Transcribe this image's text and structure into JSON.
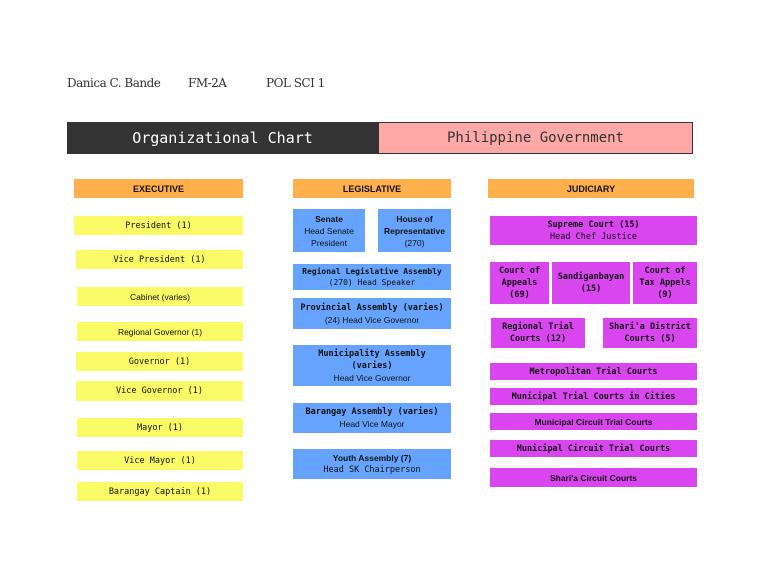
{
  "header": {
    "name": "Danica C. Bande",
    "section": "FM-2A",
    "course": "POL SCI 1"
  },
  "title": {
    "left": "Organizational Chart",
    "right": "Philippine Government"
  },
  "columns": {
    "executive": "EXECUTIVE",
    "legislative": "LEGISLATIVE",
    "judiciary": "JUDICIARY"
  },
  "executive": [
    "President (1)",
    "Vice President (1)",
    "Cabinet (varies)",
    "Regional Governor (1)",
    "Governor (1)",
    "Vice Governor (1)",
    "Mayor (1)",
    "Vice Mayor (1)",
    "Barangay Captain (1)"
  ],
  "legislative": [
    {
      "title": "Senate",
      "sub": "Head Senate President"
    },
    {
      "title": "House of Representative",
      "sub": "(270)"
    },
    {
      "title": "Regional Legislative Assembly",
      "sub": "(270) Head Speaker"
    },
    {
      "title": "Provincial Assembly (varies)",
      "sub": "(24) Head Vice Governor"
    },
    {
      "title": "Municipality Assembly (varies)",
      "sub": "Head Vice Governor"
    },
    {
      "title": "Barangay Assembly (varies)",
      "sub": "Head Vice Mayor"
    },
    {
      "title": "Youth Assembly (7)",
      "sub": "Head SK Chairperson"
    }
  ],
  "judiciary": [
    {
      "title": "Supreme Court (15)",
      "sub": "Head Chef Justice"
    },
    {
      "title": "Court of Appeals (69)"
    },
    {
      "title": "Sandiganbayan (15)"
    },
    {
      "title": "Court of Tax Appels (9)"
    },
    {
      "title": "Regional Trial Courts (12)"
    },
    {
      "title": "Shari'a District Courts (5)"
    },
    {
      "title": "Metropolitan Trial Courts"
    },
    {
      "title": "Municipal Trial Courts in Cities"
    },
    {
      "title": "Municipal Circuit Trial Courts"
    },
    {
      "title": "Municipal Circuit Trial Courts"
    },
    {
      "title": "Shari'a Circuit Courts"
    }
  ]
}
